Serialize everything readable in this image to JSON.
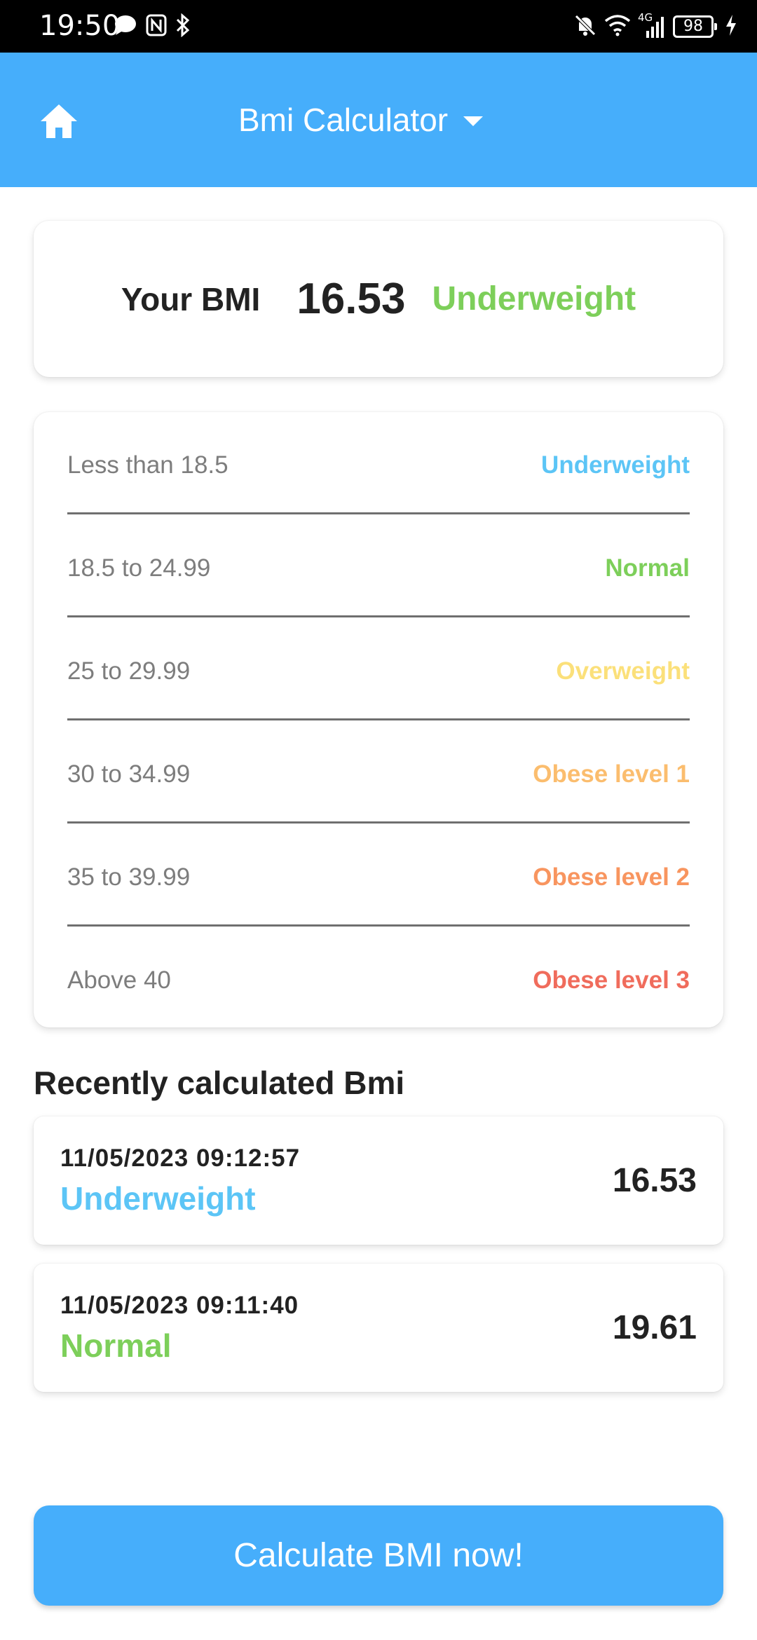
{
  "status_bar": {
    "time": "19:50",
    "battery": "98",
    "network": "4G",
    "icons": [
      "chat-bubble-icon",
      "nfc-icon",
      "bluetooth-icon",
      "bell-muted-icon",
      "wifi-icon",
      "signal-icon",
      "battery-icon",
      "charging-icon"
    ]
  },
  "app_bar": {
    "title": "Bmi Calculator",
    "home_icon": "home-icon",
    "dropdown_icon": "caret-down-icon",
    "color": "#46aefb"
  },
  "bmi_result": {
    "label": "Your BMI",
    "value": "16.53",
    "category": "Underweight",
    "category_color": "#7dcf5a"
  },
  "ranges": [
    {
      "range": "Less than 18.5",
      "category": "Underweight",
      "color": "#5cc5f6"
    },
    {
      "range": "18.5 to 24.99",
      "category": "Normal",
      "color": "#7dcf5a"
    },
    {
      "range": "25 to 29.99",
      "category": "Overweight",
      "color": "#fbe07a"
    },
    {
      "range": "30 to 34.99",
      "category": "Obese level 1",
      "color": "#fbbd6e"
    },
    {
      "range": "35 to 39.99",
      "category": "Obese level 2",
      "color": "#f8955f"
    },
    {
      "range": "Above 40",
      "category": "Obese level 3",
      "color": "#f06c5c"
    }
  ],
  "history": {
    "title": "Recently calculated Bmi",
    "items": [
      {
        "datetime": "11/05/2023 09:12:57",
        "category": "Underweight",
        "value": "16.53",
        "color": "#5cc5f6"
      },
      {
        "datetime": "11/05/2023 09:11:40",
        "category": "Normal",
        "value": "19.61",
        "color": "#7dcf5a"
      }
    ]
  },
  "calculate_button": {
    "label": "Calculate BMI now!"
  }
}
